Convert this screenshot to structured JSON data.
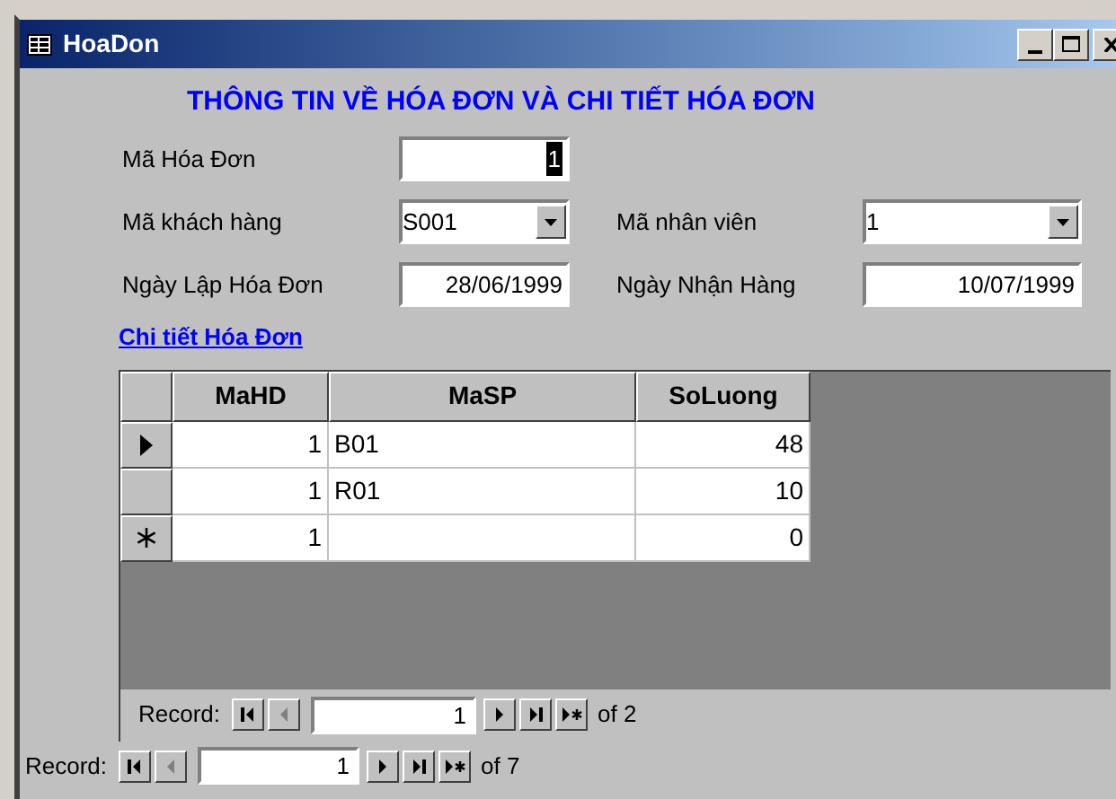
{
  "window": {
    "title": "HoaDon"
  },
  "form": {
    "heading": "THÔNG TIN VỀ HÓA ĐƠN VÀ CHI TIẾT HÓA ĐƠN",
    "rows": [
      [
        {
          "kind": "text",
          "label": "Mã Hóa Đơn",
          "value": "1",
          "selected": true
        }
      ],
      [
        {
          "kind": "combo",
          "label": "Mã khách hàng",
          "value": "S001",
          "selected": false
        },
        {
          "kind": "combo",
          "label": "Mã nhân viên",
          "value": "1",
          "selected": false
        }
      ],
      [
        {
          "kind": "text",
          "label": "Ngày Lập Hóa Đơn",
          "value": "28/06/1999",
          "selected": false
        },
        {
          "kind": "text",
          "label": "Ngày Nhận Hàng",
          "value": "10/07/1999",
          "selected": false
        }
      ]
    ],
    "link": "Chi tiết Hóa Đơn"
  },
  "subform": {
    "columns": [
      "MaHD",
      "MaSP",
      "SoLuong"
    ],
    "rows": [
      {
        "kind": "record",
        "current": true,
        "cells": [
          "1",
          "B01",
          "48"
        ]
      },
      {
        "kind": "record",
        "current": false,
        "cells": [
          "1",
          "R01",
          "10"
        ]
      },
      {
        "kind": "new",
        "current": false,
        "cells": [
          "1",
          null,
          "0"
        ]
      }
    ],
    "navigator": {
      "label": "Record:",
      "value": "1",
      "total": "of 2",
      "buttons": [
        {
          "kind": "first",
          "disabled": false
        },
        {
          "kind": "prev",
          "disabled": true
        },
        {
          "kind": "next",
          "disabled": false
        },
        {
          "kind": "last",
          "disabled": false
        },
        {
          "kind": "new",
          "disabled": false
        }
      ]
    }
  },
  "navigator": {
    "label": "Record:",
    "value": "1",
    "total": "of 7",
    "buttons": [
      {
        "kind": "first",
        "disabled": false
      },
      {
        "kind": "prev",
        "disabled": true
      },
      {
        "kind": "next",
        "disabled": false
      },
      {
        "kind": "last",
        "disabled": false
      },
      {
        "kind": "new",
        "disabled": false
      }
    ]
  }
}
